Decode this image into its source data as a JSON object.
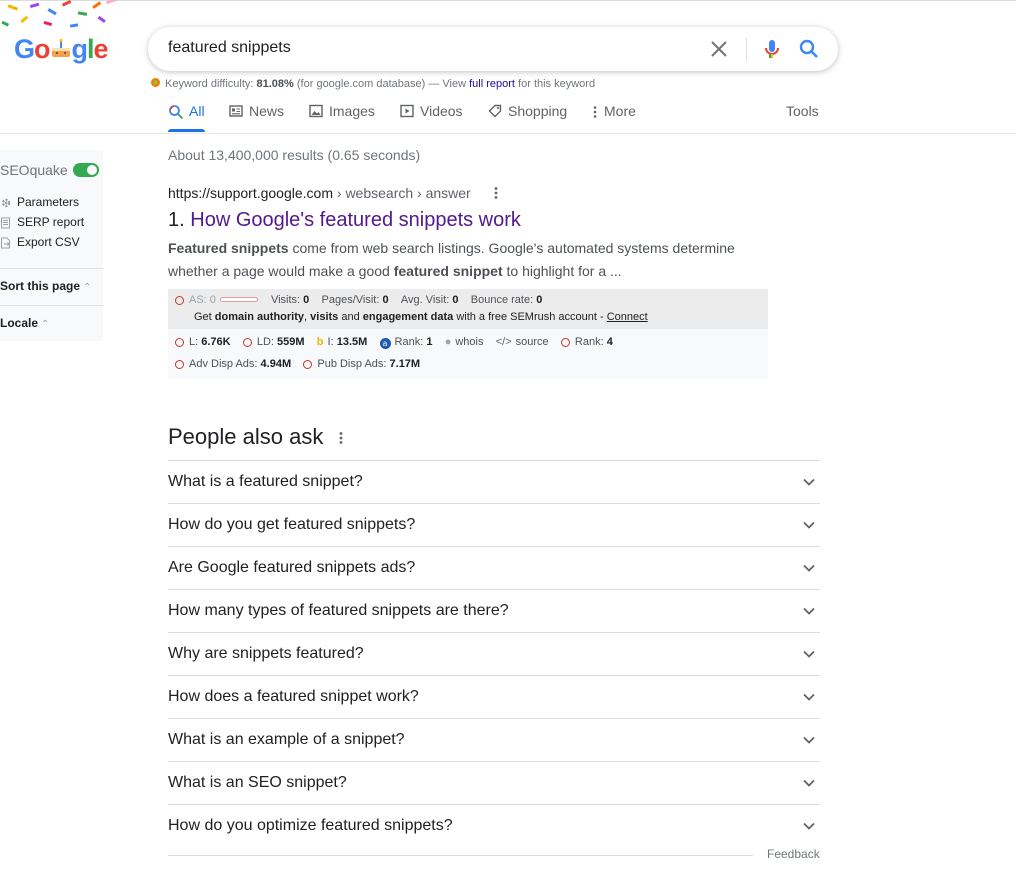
{
  "logo": {
    "text": "Google"
  },
  "search": {
    "query": "featured snippets"
  },
  "keyword_difficulty": {
    "label": "Keyword difficulty:",
    "value": "81.08%",
    "note": "(for google.com database) — View",
    "link": "full report",
    "suffix": "for this keyword"
  },
  "tabs": [
    {
      "label": "All",
      "active": true
    },
    {
      "label": "News"
    },
    {
      "label": "Images"
    },
    {
      "label": "Videos"
    },
    {
      "label": "Shopping"
    },
    {
      "label": "More"
    }
  ],
  "tools_label": "Tools",
  "sidebar": {
    "title": "SEOquake",
    "toggle_on": true,
    "items": [
      "Parameters",
      "SERP report",
      "Export CSV"
    ],
    "sort_label": "Sort this page",
    "locale_label": "Locale"
  },
  "results": {
    "stats": "About 13,400,000 results (0.65 seconds)",
    "items": [
      {
        "url_host": "https://support.google.com",
        "url_path": " › websearch › answer",
        "number": "1.",
        "title": "How Google's featured snippets work",
        "snippet_b1": "Featured snippets",
        "snippet_t1": " come from web search listings. Google's automated systems determine whether a page would make a good ",
        "snippet_b2": "featured snippet",
        "snippet_t2": " to highlight for a ..."
      }
    ]
  },
  "seoquake_bar": {
    "as_label": "AS: 0",
    "visits_label": "Visits:",
    "visits": "0",
    "pages_label": "Pages/Visit:",
    "pages": "0",
    "avg_label": "Avg. Visit:",
    "avg": "0",
    "bounce_label": "Bounce rate:",
    "bounce": "0",
    "msg_get": "Get",
    "msg_b1": "domain authority",
    "msg_comma": ",",
    "msg_b2": "visits",
    "msg_and": "and",
    "msg_b3": "engagement data",
    "msg_rest": "with a free SEMrush account -",
    "msg_link": "Connect",
    "l_label": "L:",
    "l": "6.76K",
    "ld_label": "LD:",
    "ld": "559M",
    "i_label": "I:",
    "i": "13.5M",
    "rank1_label": "Rank:",
    "rank1": "1",
    "whois": "whois",
    "source": "source",
    "rank2_label": "Rank:",
    "rank2": "4",
    "adv_label": "Adv Disp Ads:",
    "adv": "4.94M",
    "pub_label": "Pub Disp Ads:",
    "pub": "7.17M"
  },
  "paa": {
    "title": "People also ask",
    "questions": [
      "What is a featured snippet?",
      "How do you get featured snippets?",
      "Are Google featured snippets ads?",
      "How many types of featured snippets are there?",
      "Why are snippets featured?",
      "How does a featured snippet work?",
      "What is an example of a snippet?",
      "What is an SEO snippet?",
      "How do you optimize featured snippets?"
    ],
    "feedback": "Feedback"
  },
  "colors": {
    "link_blue": "#1a73e8",
    "visited_title": "#52188c",
    "toggle_green": "#34a853"
  }
}
